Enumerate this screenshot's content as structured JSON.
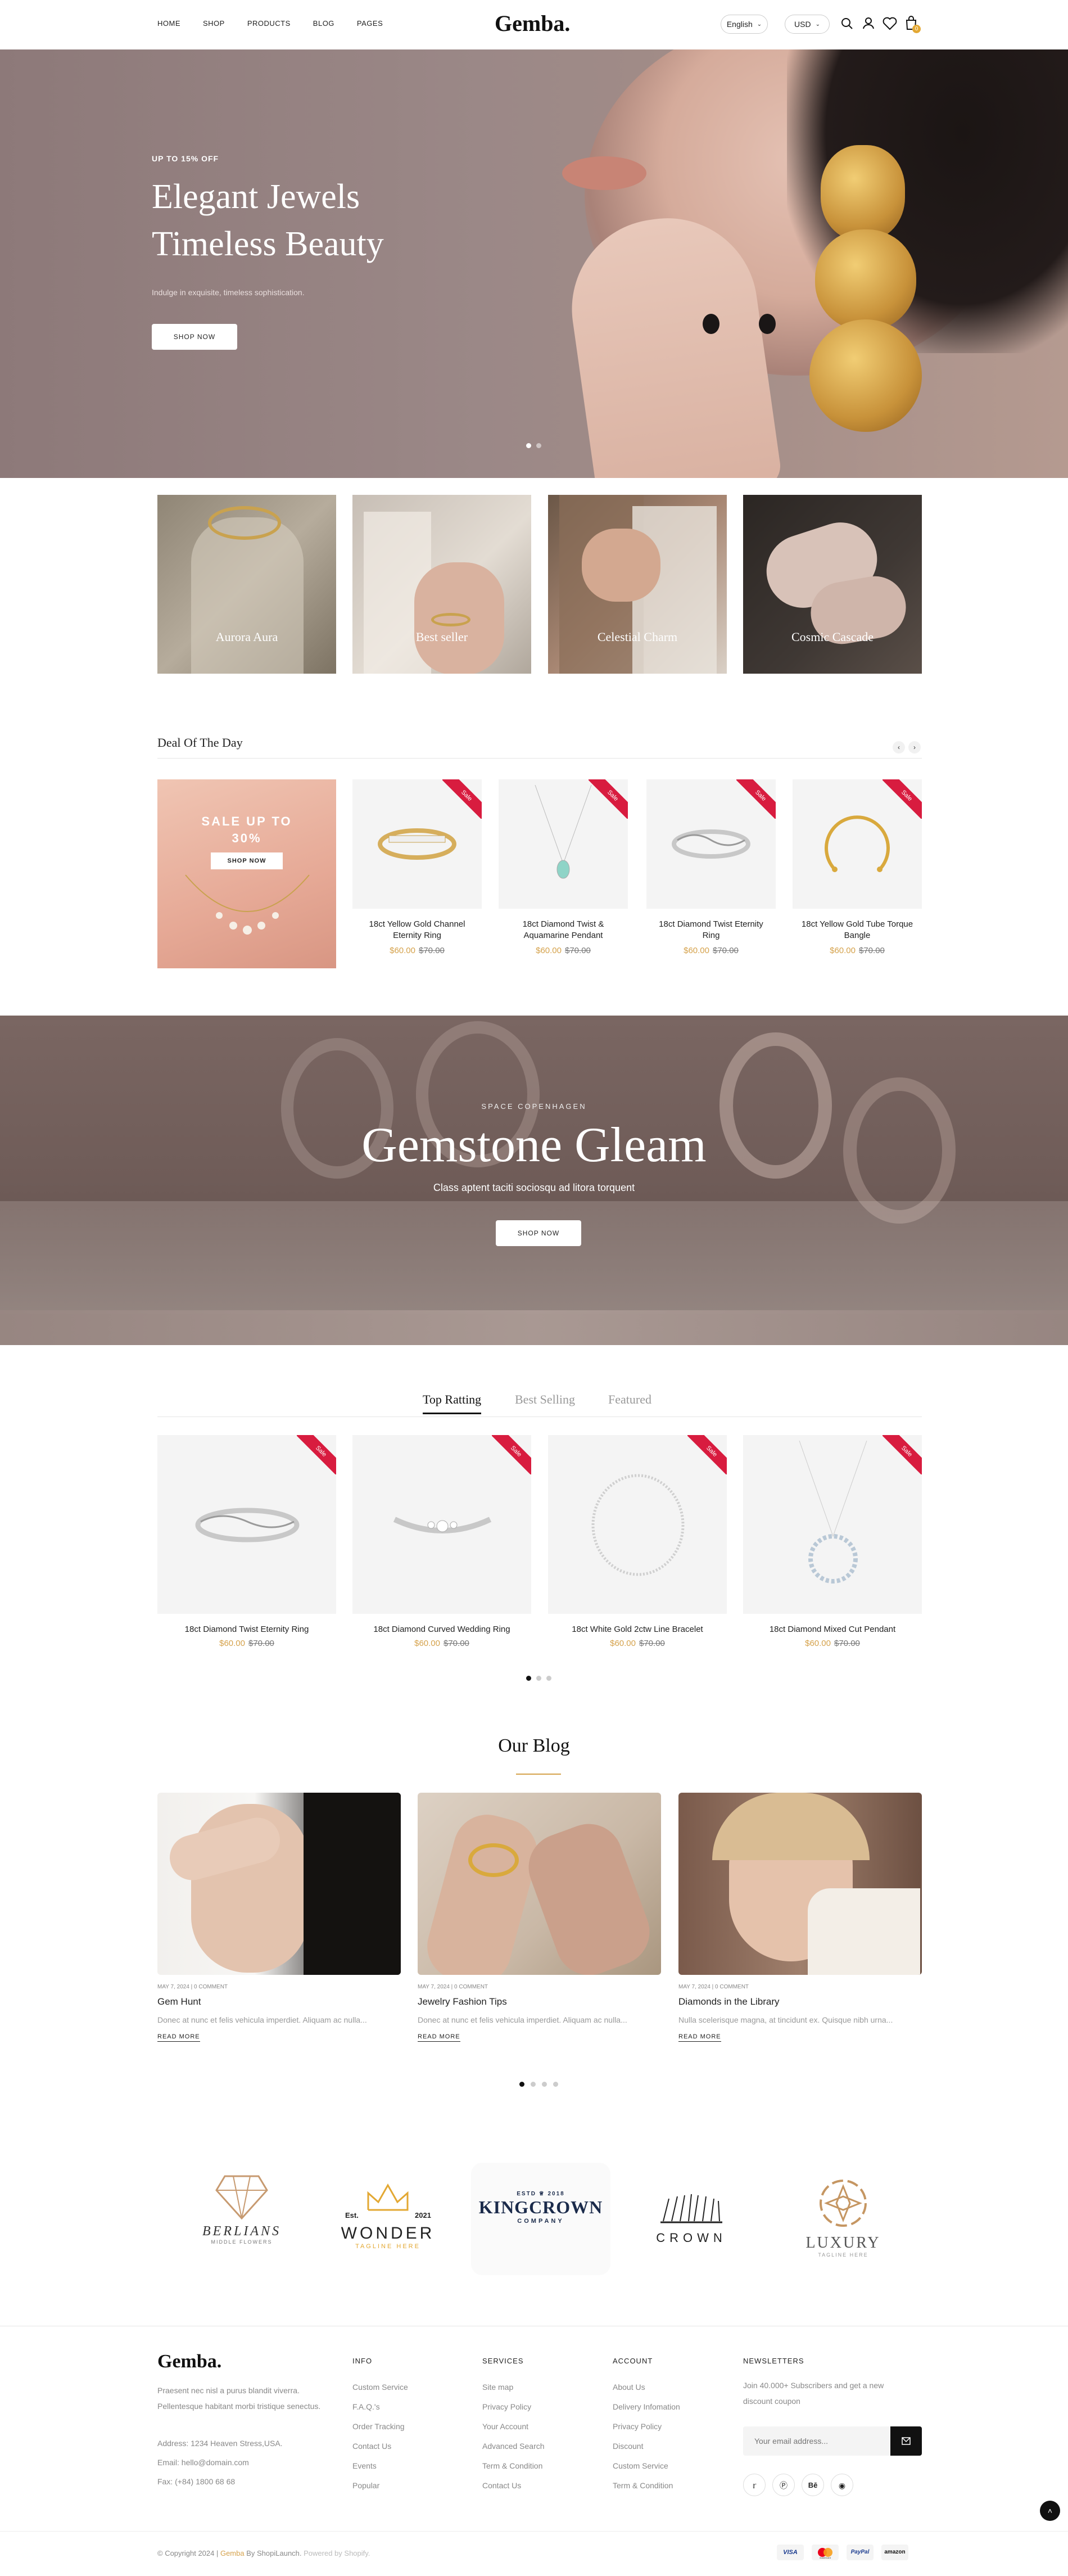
{
  "header": {
    "nav": [
      "HOME",
      "SHOP",
      "PRODUCTS",
      "BLOG",
      "PAGES"
    ],
    "logo": "Gemba.",
    "language": "English",
    "currency": "USD",
    "cart_count": "0"
  },
  "hero": {
    "eyebrow": "UP TO 15% OFF",
    "title_line1": "Elegant Jewels",
    "title_line2": "Timeless Beauty",
    "subtitle": "Indulge in exquisite, timeless sophistication.",
    "button": "SHOP NOW"
  },
  "categories": [
    "Aurora Aura",
    "Best seller",
    "Celestial Charm",
    "Cosmic Cascade"
  ],
  "deal": {
    "title": "Deal Of The Day",
    "promo_line1": "SALE UP TO",
    "promo_line2": "30%",
    "promo_button": "SHOP NOW",
    "sale_badge": "Sale",
    "products": [
      {
        "name": "18ct Yellow Gold Channel Eternity Ring",
        "price": "$60.00",
        "old": "$70.00"
      },
      {
        "name": "18ct Diamond Twist & Aquamarine Pendant",
        "price": "$60.00",
        "old": "$70.00"
      },
      {
        "name": "18ct Diamond Twist Eternity Ring",
        "price": "$60.00",
        "old": "$70.00"
      },
      {
        "name": "18ct Yellow Gold Tube Torque Bangle",
        "price": "$60.00",
        "old": "$70.00"
      }
    ]
  },
  "banner": {
    "eyebrow": "SPACE COPENHAGEN",
    "title": "Gemstone Gleam",
    "subtitle": "Class aptent taciti sociosqu ad litora torquent",
    "button": "SHOP NOW"
  },
  "tabs": {
    "items": [
      "Top Ratting",
      "Best Selling",
      "Featured"
    ],
    "active": "Top Ratting"
  },
  "top_products": [
    {
      "name": "18ct Diamond Twist Eternity Ring",
      "price": "$60.00",
      "old": "$70.00"
    },
    {
      "name": "18ct Diamond Curved Wedding Ring",
      "price": "$60.00",
      "old": "$70.00"
    },
    {
      "name": "18ct White Gold 2ctw Line Bracelet",
      "price": "$60.00",
      "old": "$70.00"
    },
    {
      "name": "18ct Diamond Mixed Cut Pendant",
      "price": "$60.00",
      "old": "$70.00"
    }
  ],
  "blog": {
    "title": "Our Blog",
    "posts": [
      {
        "meta": "MAY 7, 2024 | 0 COMMENT",
        "title": "Gem Hunt",
        "excerpt": "Donec at nunc et felis vehicula imperdiet. Aliquam ac nulla...",
        "more": "READ MORE"
      },
      {
        "meta": "MAY 7, 2024 | 0 COMMENT",
        "title": "Jewelry Fashion Tips",
        "excerpt": "Donec at nunc et felis vehicula imperdiet. Aliquam ac nulla...",
        "more": "READ MORE"
      },
      {
        "meta": "MAY 7, 2024 | 0 COMMENT",
        "title": "Diamonds in the Library",
        "excerpt": "Nulla scelerisque magna, at tincidunt ex. Quisque nibh urna...",
        "more": "READ MORE"
      }
    ]
  },
  "brands": [
    {
      "name": "BERLIANS",
      "sub": "MIDDLE FLOWERS"
    },
    {
      "name": "WONDER",
      "sub": "TAGLINE HERE",
      "top_left": "Est.",
      "top_right": "2021"
    },
    {
      "name": "KINGCROWN",
      "sub": "COMPANY",
      "top_left": "ESTD",
      "top_right": "2018"
    },
    {
      "name": "CROWN",
      "sub": ""
    },
    {
      "name": "LUXURY",
      "sub": "TAGLINE HERE"
    }
  ],
  "footer": {
    "logo": "Gemba.",
    "about": "Praesent nec nisl a purus blandit viverra. Pellentesque habitant morbi tristique senectus.",
    "address": "Address: 1234 Heaven Stress,USA.",
    "email": "Email: hello@domain.com",
    "fax": "Fax: (+84) 1800 68 68",
    "info_title": "INFO",
    "info": [
      "Custom Service",
      "F.A.Q.'s",
      "Order Tracking",
      "Contact Us",
      "Events",
      "Popular"
    ],
    "services_title": "SERVICES",
    "services": [
      "Site map",
      "Privacy Policy",
      "Your Account",
      "Advanced Search",
      "Term & Condition",
      "Contact Us"
    ],
    "account_title": "ACCOUNT",
    "account": [
      "About Us",
      "Delivery Infomation",
      "Privacy Policy",
      "Discount",
      "Custom Service",
      "Term & Condition"
    ],
    "news_title": "NEWSLETTERS",
    "news_text": "Join 40.000+ Subscribers and get a new discount coupon",
    "email_placeholder": "Your email address...",
    "copyright_a": "© Copyright 2024 | ",
    "copyright_b": "Gemba",
    "copyright_c": " By ShopiLaunch. ",
    "copyright_d": "Powered by Shopify.",
    "payments": [
      "VISA",
      "mastercard",
      "PayPal",
      "amazon"
    ]
  }
}
